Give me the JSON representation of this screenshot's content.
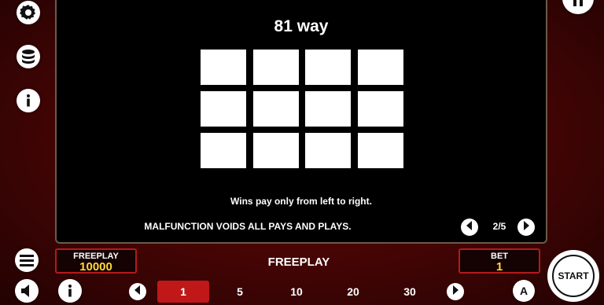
{
  "ways_panel": {
    "title": "81 way",
    "note": "Wins pay only from left to right."
  },
  "footer": {
    "malfunction_text": "MALFUNCTION VOIDS ALL PAYS AND PLAYS.",
    "page_indicator": "2/5"
  },
  "freeplay_box": {
    "label": "FREEPLAY",
    "value": "10000"
  },
  "center_label": "FREEPLAY",
  "bet_box": {
    "label": "BET",
    "value": "1"
  },
  "bet_options": [
    "1",
    "5",
    "10",
    "20",
    "30"
  ],
  "selected_bet": "1",
  "start_label": "START",
  "auto_label": "A",
  "colors": {
    "accent_red": "#b41a1a",
    "value_yellow": "#ffd83a",
    "selected_bg": "#c01818"
  }
}
